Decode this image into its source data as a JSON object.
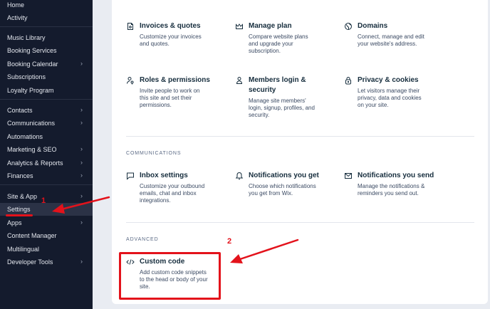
{
  "sidebar": {
    "items": [
      {
        "label": "Home",
        "chevron": false
      },
      {
        "label": "Activity",
        "chevron": false
      },
      {
        "label": "Music Library",
        "chevron": false
      },
      {
        "label": "Booking Services",
        "chevron": false
      },
      {
        "label": "Booking Calendar",
        "chevron": true
      },
      {
        "label": "Subscriptions",
        "chevron": false
      },
      {
        "label": "Loyalty Program",
        "chevron": false
      },
      {
        "label": "Contacts",
        "chevron": true
      },
      {
        "label": "Communications",
        "chevron": true
      },
      {
        "label": "Automations",
        "chevron": false
      },
      {
        "label": "Marketing & SEO",
        "chevron": true
      },
      {
        "label": "Analytics & Reports",
        "chevron": true
      },
      {
        "label": "Finances",
        "chevron": true
      },
      {
        "label": "Site & App",
        "chevron": true
      },
      {
        "label": "Settings",
        "chevron": false
      },
      {
        "label": "Apps",
        "chevron": true
      },
      {
        "label": "Content Manager",
        "chevron": false
      },
      {
        "label": "Multilingual",
        "chevron": false
      },
      {
        "label": "Developer Tools",
        "chevron": true
      }
    ],
    "chevron_glyph": "›",
    "active_item": "Settings"
  },
  "cards": {
    "invoices": {
      "title": "Invoices & quotes",
      "desc": [
        "Customize your invoices",
        "and quotes."
      ],
      "icon": "invoice-icon"
    },
    "manage_plan": {
      "title": "Manage plan",
      "desc": [
        "Compare website plans",
        "and upgrade your",
        "subscription."
      ],
      "icon": "crown-icon"
    },
    "domains": {
      "title": "Domains",
      "desc": [
        "Connect, manage and edit",
        "your website's address."
      ],
      "icon": "globe-icon"
    },
    "roles": {
      "title": "Roles & permissions",
      "desc": [
        "Invite people to work on",
        "this site and set their",
        "permissions."
      ],
      "icon": "user-key-icon"
    },
    "members": {
      "title": "Members login & security",
      "desc": [
        "Manage site members'",
        "login, signup, profiles, and",
        "security."
      ],
      "icon": "person-icon"
    },
    "privacy": {
      "title": "Privacy & cookies",
      "desc": [
        "Let visitors manage their",
        "privacy, data and cookies",
        "on your site."
      ],
      "icon": "lock-icon"
    },
    "inbox": {
      "title": "Inbox settings",
      "desc": [
        "Customize your outbound",
        "emails, chat and inbox",
        "integrations."
      ],
      "icon": "chat-icon"
    },
    "notif_get": {
      "title": "Notifications you get",
      "desc": [
        "Choose which notifications",
        "you get from Wix."
      ],
      "icon": "bell-icon"
    },
    "notif_send": {
      "title": "Notifications you send",
      "desc": [
        "Manage the notifications &",
        "reminders you send out."
      ],
      "icon": "envelope-icon"
    },
    "custom_code": {
      "title": "Custom code",
      "desc": [
        "Add custom code snippets",
        "to the head or body of your",
        "site."
      ],
      "icon": "code-icon"
    }
  },
  "sections": {
    "communications": "COMMUNICATIONS",
    "advanced": "ADVANCED"
  },
  "annotations": {
    "marker1": "1",
    "marker2": "2",
    "color": "#e3121b"
  }
}
